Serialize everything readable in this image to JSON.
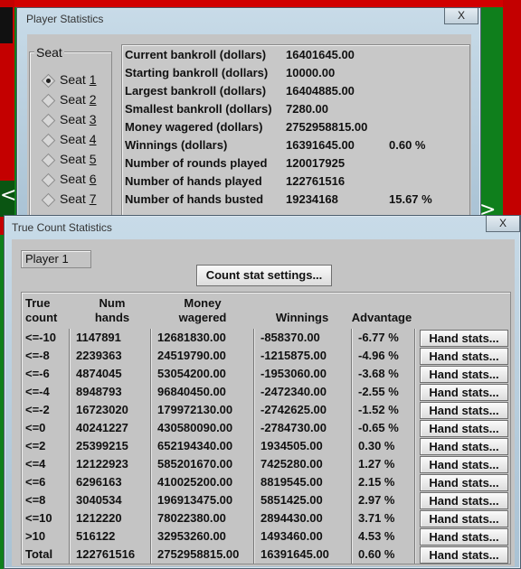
{
  "player_statistics": {
    "title": "Player Statistics",
    "close_label": "X",
    "seat_group_label": "Seat",
    "seats": [
      {
        "prefix": "Seat ",
        "num": "1",
        "selected": true
      },
      {
        "prefix": "Seat ",
        "num": "2",
        "selected": false
      },
      {
        "prefix": "Seat ",
        "num": "3",
        "selected": false
      },
      {
        "prefix": "Seat ",
        "num": "4",
        "selected": false
      },
      {
        "prefix": "Seat ",
        "num": "5",
        "selected": false
      },
      {
        "prefix": "Seat ",
        "num": "6",
        "selected": false
      },
      {
        "prefix": "Seat ",
        "num": "7",
        "selected": false
      }
    ],
    "stats": [
      {
        "label": "Current bankroll (dollars)",
        "value": "16401645.00",
        "extra": ""
      },
      {
        "label": "Starting bankroll (dollars)",
        "value": "10000.00",
        "extra": ""
      },
      {
        "label": "Largest bankroll (dollars)",
        "value": "16404885.00",
        "extra": ""
      },
      {
        "label": "Smallest bankroll (dollars)",
        "value": "7280.00",
        "extra": ""
      },
      {
        "label": "Money wagered (dollars)",
        "value": "2752958815.00",
        "extra": ""
      },
      {
        "label": "Winnings (dollars)",
        "value": "16391645.00",
        "extra": "0.60 %"
      },
      {
        "label": "Number of rounds played",
        "value": "120017925",
        "extra": ""
      },
      {
        "label": "Number of hands played",
        "value": "122761516",
        "extra": ""
      },
      {
        "label": "Number of hands busted",
        "value": "19234168",
        "extra": "15.67 %"
      }
    ]
  },
  "true_count_statistics": {
    "title": "True Count Statistics",
    "close_label": "X",
    "player_label": "Player 1",
    "settings_button": "Count stat settings...",
    "headers": {
      "true_count": [
        "True",
        "count"
      ],
      "num_hands": [
        "Num",
        "hands"
      ],
      "money_wagered": [
        "Money",
        "wagered"
      ],
      "winnings": "Winnings",
      "advantage": "Advantage"
    },
    "hand_stats_label": "Hand stats...",
    "rows": [
      {
        "count": "<=-10",
        "hands": "1147891",
        "wagered": "12681830.00",
        "winnings": "-858370.00",
        "advantage": "-6.77 %"
      },
      {
        "count": "<=-8",
        "hands": "2239363",
        "wagered": "24519790.00",
        "winnings": "-1215875.00",
        "advantage": "-4.96 %"
      },
      {
        "count": "<=-6",
        "hands": "4874045",
        "wagered": "53054200.00",
        "winnings": "-1953060.00",
        "advantage": "-3.68 %"
      },
      {
        "count": "<=-4",
        "hands": "8948793",
        "wagered": "96840450.00",
        "winnings": "-2472340.00",
        "advantage": "-2.55 %"
      },
      {
        "count": "<=-2",
        "hands": "16723020",
        "wagered": "179972130.00",
        "winnings": "-2742625.00",
        "advantage": "-1.52 %"
      },
      {
        "count": "<=0",
        "hands": "40241227",
        "wagered": "430580090.00",
        "winnings": "-2784730.00",
        "advantage": "-0.65 %"
      },
      {
        "count": "<=2",
        "hands": "25399215",
        "wagered": "652194340.00",
        "winnings": "1934505.00",
        "advantage": "0.30 %"
      },
      {
        "count": "<=4",
        "hands": "12122923",
        "wagered": "585201670.00",
        "winnings": "7425280.00",
        "advantage": "1.27 %"
      },
      {
        "count": "<=6",
        "hands": "6296163",
        "wagered": "410025200.00",
        "winnings": "8819545.00",
        "advantage": "2.15 %"
      },
      {
        "count": "<=8",
        "hands": "3040534",
        "wagered": "196913475.00",
        "winnings": "5851425.00",
        "advantage": "2.97 %"
      },
      {
        "count": "<=10",
        "hands": "1212220",
        "wagered": "78022380.00",
        "winnings": "2894430.00",
        "advantage": "3.71 %"
      },
      {
        "count": ">10",
        "hands": "516122",
        "wagered": "32953260.00",
        "winnings": "1493460.00",
        "advantage": "4.53 %"
      },
      {
        "count": "Total",
        "hands": "122761516",
        "wagered": "2752958815.00",
        "winnings": "16391645.00",
        "advantage": "0.60 %"
      }
    ]
  },
  "background": {
    "chevron_left": "<",
    "chevron_right": ">"
  },
  "colors": {
    "felt": "#0f7f1c",
    "table_red": "#c40000",
    "dialog_face": "#c4c4c4",
    "window_frame": "#a9c2d4"
  }
}
